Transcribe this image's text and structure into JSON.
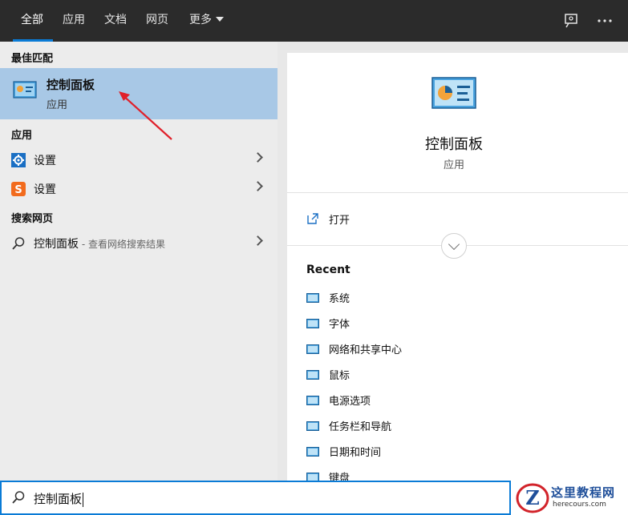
{
  "tabs": [
    {
      "label": "全部",
      "active": true
    },
    {
      "label": "应用"
    },
    {
      "label": "文档"
    },
    {
      "label": "网页"
    },
    {
      "label": "更多"
    }
  ],
  "top_icons": [
    "feedback-icon",
    "more-icon"
  ],
  "left": {
    "best_match_heading": "最佳匹配",
    "best_match": {
      "title": "控制面板",
      "subtitle": "应用",
      "icon": "control-panel-icon"
    },
    "apps_heading": "应用",
    "apps": [
      {
        "label": "设置",
        "icon": "settings-gear-icon"
      },
      {
        "label": "设置",
        "icon": "sogou-s-icon"
      }
    ],
    "web_heading": "搜索网页",
    "web": {
      "query": "控制面板",
      "suffix": " - 查看网络搜索结果",
      "icon": "search-icon"
    }
  },
  "right": {
    "title": "控制面板",
    "subtitle": "应用",
    "open_label": "打开",
    "recent_heading": "Recent",
    "recent": [
      "系统",
      "字体",
      "网络和共享中心",
      "鼠标",
      "电源选项",
      "任务栏和导航",
      "日期和时间",
      "键盘"
    ]
  },
  "search": {
    "value": "控制面板"
  },
  "watermark": {
    "title": "这里教程网",
    "url": "herecours.com"
  },
  "colors": {
    "accent": "#0a7bd6",
    "selected": "#a8c8e6",
    "topbar": "#2b2b2b",
    "arrow": "#e0202a"
  }
}
